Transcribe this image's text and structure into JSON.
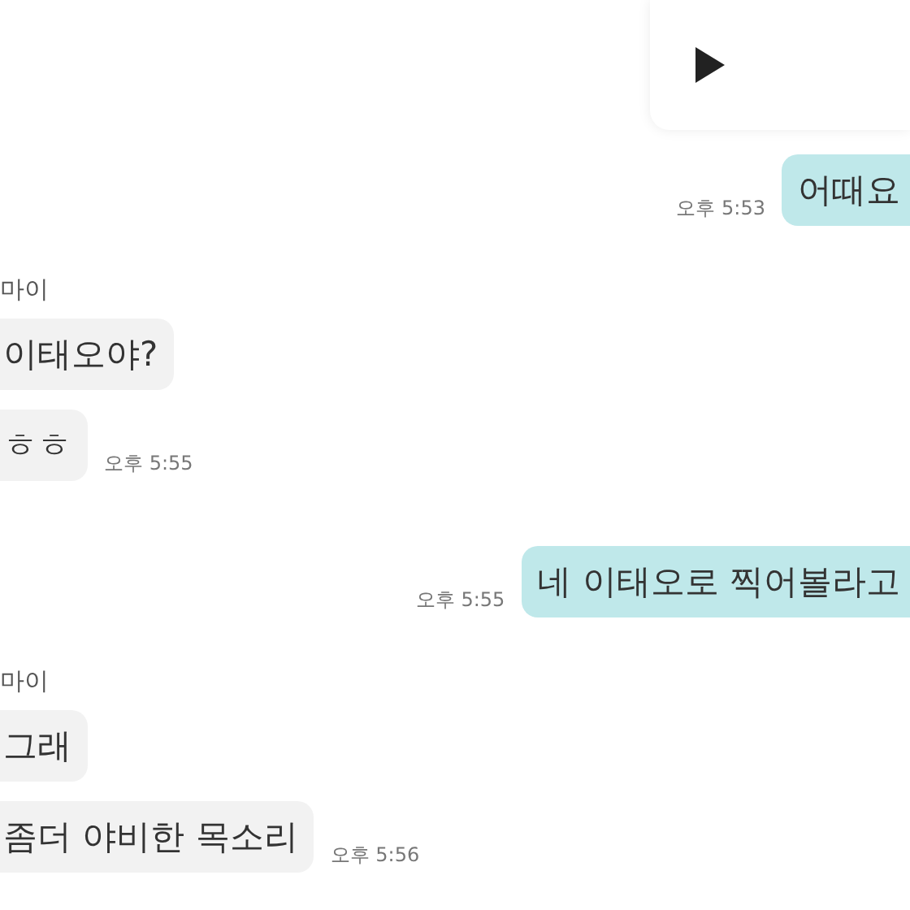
{
  "messages": [
    {
      "kind": "video"
    },
    {
      "kind": "sent",
      "text": "어때요",
      "time": "오후 5:53"
    },
    {
      "kind": "name",
      "text": "마이"
    },
    {
      "kind": "received",
      "text": "이태오야?"
    },
    {
      "kind": "received",
      "text": "ㅎㅎ",
      "time": "오후 5:55"
    },
    {
      "kind": "sent",
      "text": "네 이태오로 찍어볼라고",
      "time": "오후 5:55"
    },
    {
      "kind": "name",
      "text": "마이"
    },
    {
      "kind": "received",
      "text": "그래"
    },
    {
      "kind": "received",
      "text": "좀더 야비한 목소리",
      "time": "오후 5:56"
    }
  ]
}
